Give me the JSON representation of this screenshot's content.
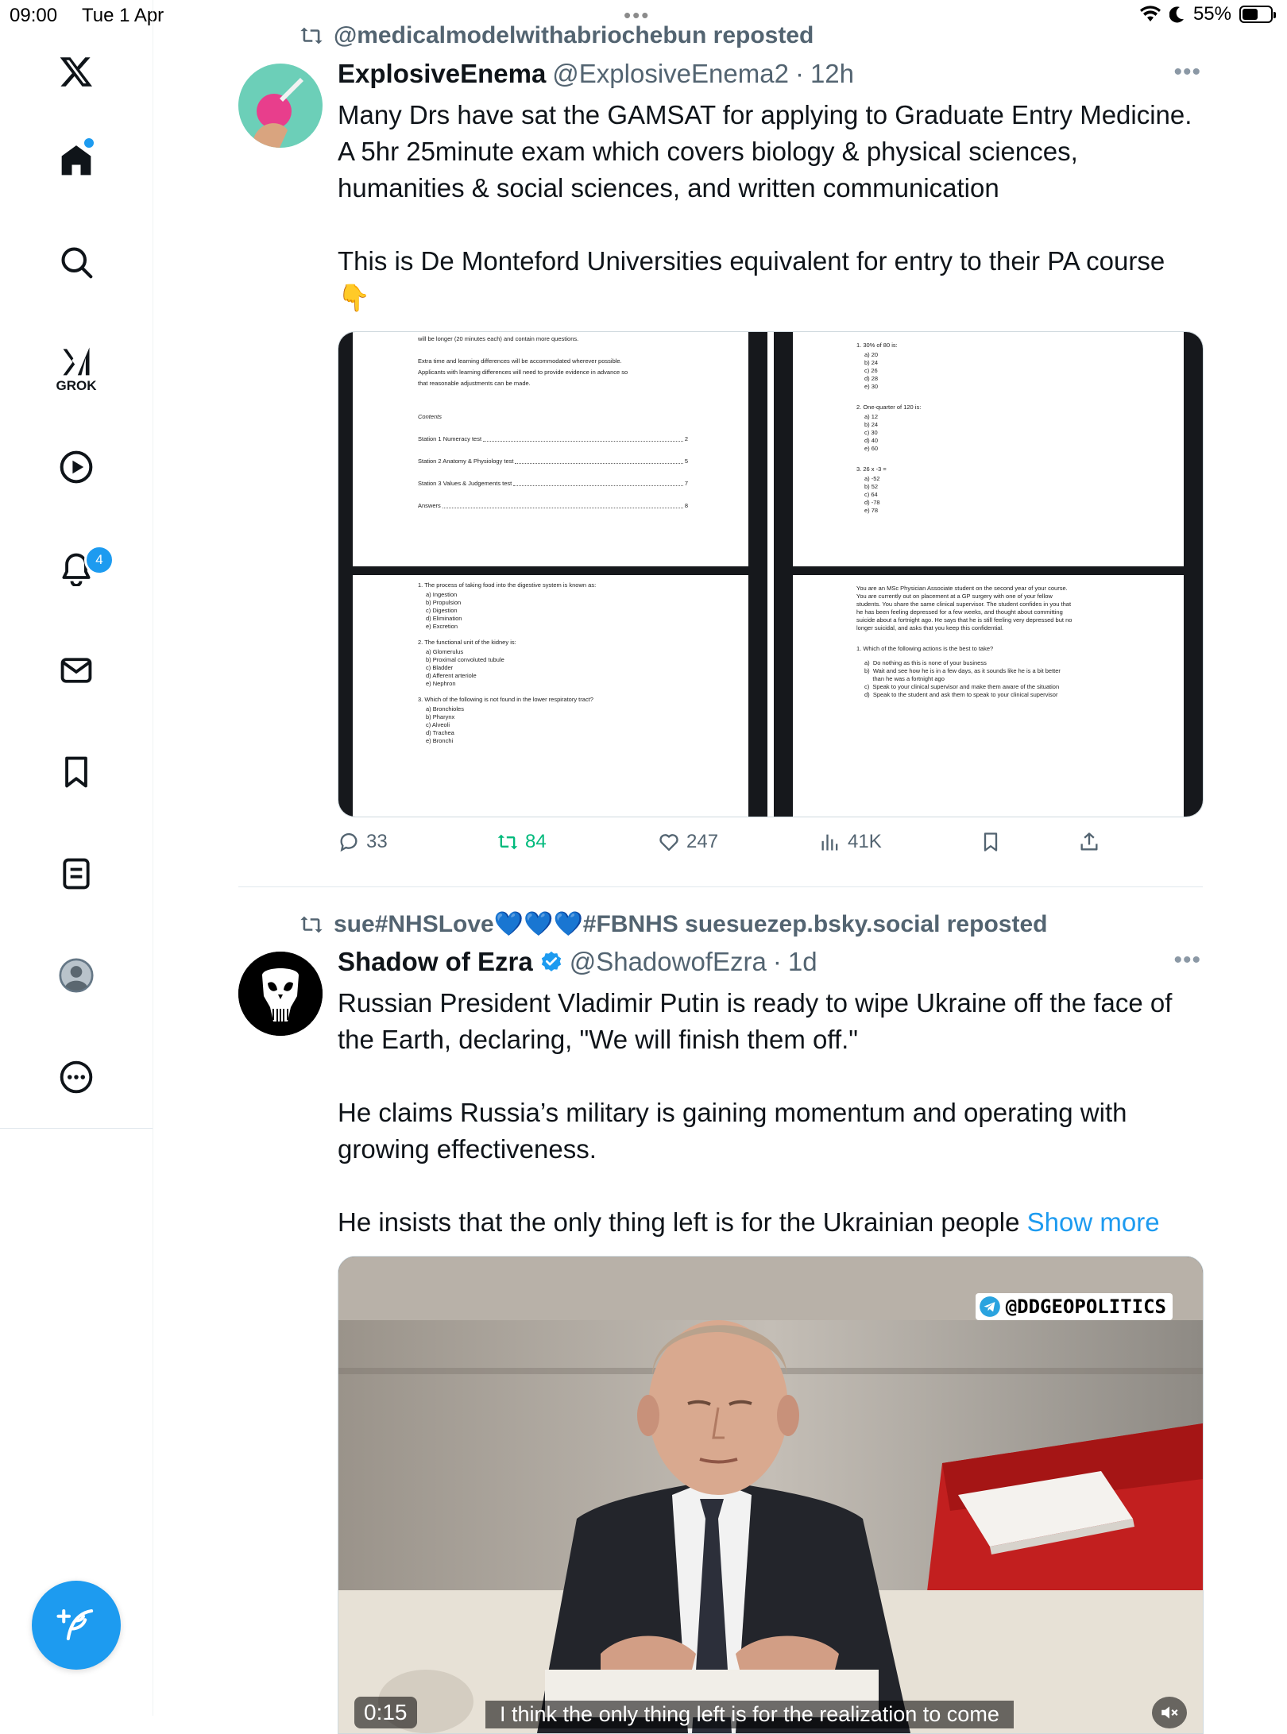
{
  "status_bar": {
    "time": "09:00",
    "date": "Tue 1 Apr",
    "battery": "55%",
    "battery_level": 0.55
  },
  "sidebar": {
    "logo": "x-logo-icon",
    "items": [
      {
        "icon": "home-icon",
        "name": "home"
      },
      {
        "icon": "search-icon",
        "name": "explore"
      },
      {
        "icon": "grok-icon",
        "name": "grok",
        "label": "GROK"
      },
      {
        "icon": "play-icon",
        "name": "video"
      },
      {
        "icon": "bell-icon",
        "name": "notifications",
        "badge": "4"
      },
      {
        "icon": "mail-icon",
        "name": "messages"
      },
      {
        "icon": "bookmark-icon",
        "name": "bookmarks"
      },
      {
        "icon": "list-icon",
        "name": "lists"
      },
      {
        "icon": "avatar-icon",
        "name": "profile"
      },
      {
        "icon": "more-icon",
        "name": "more"
      }
    ],
    "compose_icon": "compose-icon"
  },
  "post1": {
    "repost_by": "@medicalmodelwithabriochebun reposted",
    "name": "ExplosiveEnema",
    "handle": "@ExplosiveEnema2",
    "separator": "·",
    "time": "12h",
    "text": "Many Drs have sat the GAMSAT for applying to Graduate Entry Medicine. A 5hr 25minute exam which covers biology & physical sciences, humanities & social sciences, and written communication\n\nThis is De Monteford Universities equivalent for entry to their PA course 👇",
    "doc_left": {
      "intro": [
        "will be longer (20 minutes each) and contain more questions.",
        "",
        "Extra time and learning differences will be accommodated wherever possible.",
        "Applicants with learning differences will need to provide evidence in advance so",
        "that reasonable adjustments can be made."
      ],
      "contents_title": "Contents",
      "contents": [
        {
          "label": "Station 1 Numeracy test",
          "page": "2"
        },
        {
          "label": "Station 2 Anatomy & Physiology test",
          "page": "5"
        },
        {
          "label": "Station 3 Values & Judgements test",
          "page": "7"
        },
        {
          "label": "Answers",
          "page": "8"
        }
      ],
      "questions": [
        {
          "q": "1. The process of taking food into the digestive system is known as:",
          "options": [
            "a)  Ingestion",
            "b)  Propulsion",
            "c)  Digestion",
            "d)  Elimination",
            "e)  Excretion"
          ]
        },
        {
          "q": "2. The functional unit of the kidney is:",
          "options": [
            "a)  Glomerulus",
            "b)  Proximal convoluted tubule",
            "c)  Bladder",
            "d)  Afferent arteriole",
            "e)  Nephron"
          ]
        },
        {
          "q": "3. Which of the following is not found in the lower respiratory tract?",
          "options": [
            "a)  Bronchioles",
            "b)  Pharynx",
            "c)  Alveoli",
            "d)  Trachea",
            "e)  Bronchi"
          ]
        }
      ]
    },
    "doc_right": {
      "questions": [
        {
          "q": "1. 30% of 80 is:",
          "options": [
            "a)  20",
            "b)  24",
            "c)  26",
            "d)  28",
            "e)  30"
          ]
        },
        {
          "q": "2. One-quarter of 120 is:",
          "options": [
            "a)  12",
            "b)  24",
            "c)  30",
            "d)  40",
            "e)  60"
          ]
        },
        {
          "q": "3. 26 x -3 =",
          "options": [
            "a)  -52",
            "b)  52",
            "c)  64",
            "d)  -78",
            "e)  78"
          ]
        }
      ],
      "scenario": [
        "You are an MSc Physician Associate student on the second year of your course.",
        "You are currently out on placement at a GP surgery with one of your fellow",
        "students. You share the same clinical supervisor. The student confides in you that",
        "he has been feeling depressed for a few weeks, and thought about committing",
        "suicide about a fortnight ago. He says that he is still feeling very depressed but no",
        "longer suicidal, and asks that you keep this confidential."
      ],
      "scenario_q": "1. Which of the following actions is the best to take?",
      "scenario_options": [
        "a)  Do nothing as this is none of your business",
        "b)  Wait and see how he is in a few days, as it sounds like he is a bit better",
        "     than he was a fortnight ago",
        "c)  Speak to your clinical supervisor and make them aware of the situation",
        "d)  Speak to the student and ask them to speak to your clinical supervisor"
      ]
    },
    "stats": {
      "replies": "33",
      "reposts": "84",
      "likes": "247",
      "views": "41K"
    }
  },
  "post2": {
    "repost_by": "sue#NHSLove💙💙💙#FBNHS suesuezep.bsky.social reposted",
    "name": "Shadow of Ezra",
    "handle": "@ShadowofEzra",
    "separator": "·",
    "time": "1d",
    "text": "Russian President Vladimir Putin is ready to wipe Ukraine off the face of the Earth, declaring, \"We will finish them off.\"\n\nHe claims Russia’s military is gaining momentum and operating with growing effectiveness.\n\nHe insists that the only thing left is for the Ukrainian people ",
    "show_more": "Show more",
    "video": {
      "watermark": "@DDGEOPOLITICS",
      "duration": "0:15",
      "subtitle": "I think the only thing left is for the realization to come"
    }
  },
  "colors": {
    "accent": "#1d9bf0",
    "repost_green": "#00ba7c",
    "muted": "#536471"
  }
}
